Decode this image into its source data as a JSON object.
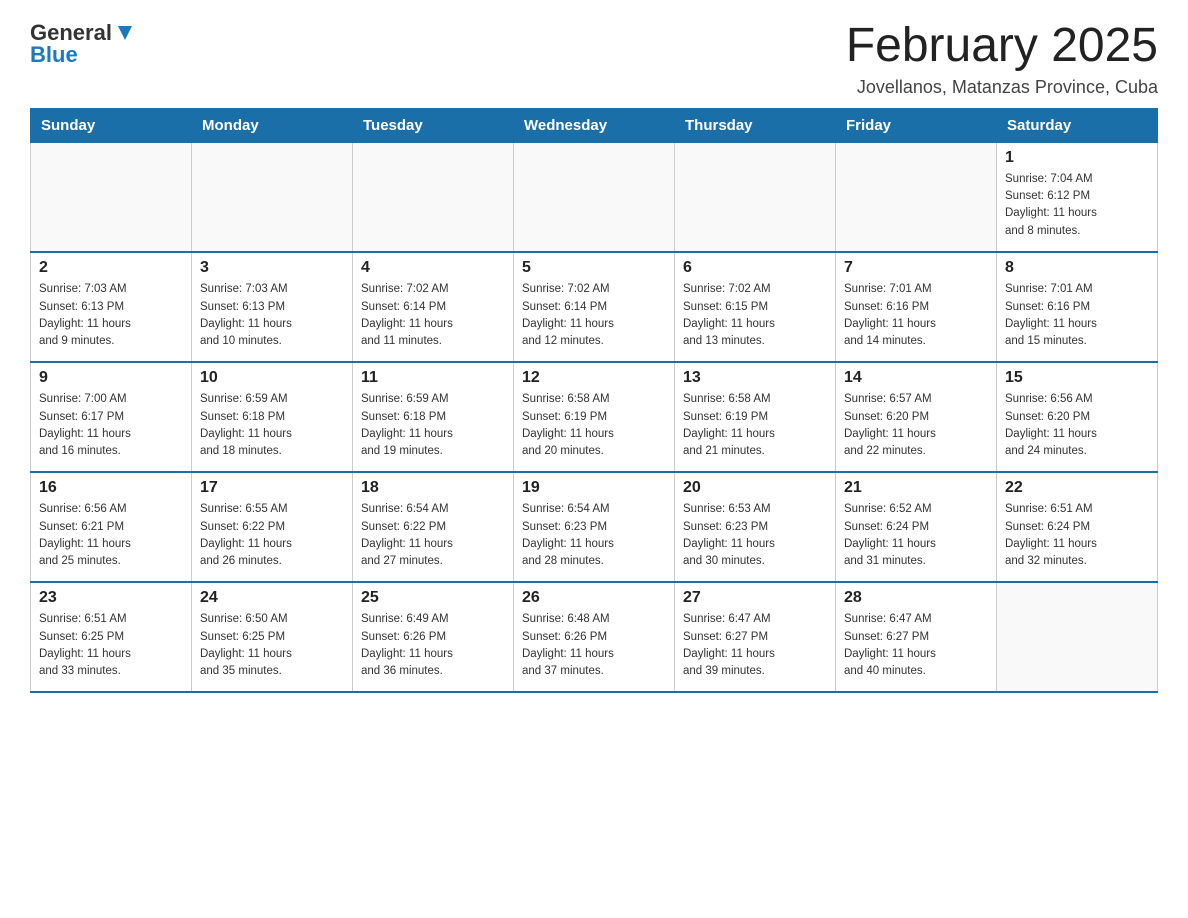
{
  "logo": {
    "general": "General",
    "blue": "Blue"
  },
  "title": "February 2025",
  "subtitle": "Jovellanos, Matanzas Province, Cuba",
  "headers": [
    "Sunday",
    "Monday",
    "Tuesday",
    "Wednesday",
    "Thursday",
    "Friday",
    "Saturday"
  ],
  "weeks": [
    [
      {
        "day": "",
        "info": ""
      },
      {
        "day": "",
        "info": ""
      },
      {
        "day": "",
        "info": ""
      },
      {
        "day": "",
        "info": ""
      },
      {
        "day": "",
        "info": ""
      },
      {
        "day": "",
        "info": ""
      },
      {
        "day": "1",
        "info": "Sunrise: 7:04 AM\nSunset: 6:12 PM\nDaylight: 11 hours\nand 8 minutes."
      }
    ],
    [
      {
        "day": "2",
        "info": "Sunrise: 7:03 AM\nSunset: 6:13 PM\nDaylight: 11 hours\nand 9 minutes."
      },
      {
        "day": "3",
        "info": "Sunrise: 7:03 AM\nSunset: 6:13 PM\nDaylight: 11 hours\nand 10 minutes."
      },
      {
        "day": "4",
        "info": "Sunrise: 7:02 AM\nSunset: 6:14 PM\nDaylight: 11 hours\nand 11 minutes."
      },
      {
        "day": "5",
        "info": "Sunrise: 7:02 AM\nSunset: 6:14 PM\nDaylight: 11 hours\nand 12 minutes."
      },
      {
        "day": "6",
        "info": "Sunrise: 7:02 AM\nSunset: 6:15 PM\nDaylight: 11 hours\nand 13 minutes."
      },
      {
        "day": "7",
        "info": "Sunrise: 7:01 AM\nSunset: 6:16 PM\nDaylight: 11 hours\nand 14 minutes."
      },
      {
        "day": "8",
        "info": "Sunrise: 7:01 AM\nSunset: 6:16 PM\nDaylight: 11 hours\nand 15 minutes."
      }
    ],
    [
      {
        "day": "9",
        "info": "Sunrise: 7:00 AM\nSunset: 6:17 PM\nDaylight: 11 hours\nand 16 minutes."
      },
      {
        "day": "10",
        "info": "Sunrise: 6:59 AM\nSunset: 6:18 PM\nDaylight: 11 hours\nand 18 minutes."
      },
      {
        "day": "11",
        "info": "Sunrise: 6:59 AM\nSunset: 6:18 PM\nDaylight: 11 hours\nand 19 minutes."
      },
      {
        "day": "12",
        "info": "Sunrise: 6:58 AM\nSunset: 6:19 PM\nDaylight: 11 hours\nand 20 minutes."
      },
      {
        "day": "13",
        "info": "Sunrise: 6:58 AM\nSunset: 6:19 PM\nDaylight: 11 hours\nand 21 minutes."
      },
      {
        "day": "14",
        "info": "Sunrise: 6:57 AM\nSunset: 6:20 PM\nDaylight: 11 hours\nand 22 minutes."
      },
      {
        "day": "15",
        "info": "Sunrise: 6:56 AM\nSunset: 6:20 PM\nDaylight: 11 hours\nand 24 minutes."
      }
    ],
    [
      {
        "day": "16",
        "info": "Sunrise: 6:56 AM\nSunset: 6:21 PM\nDaylight: 11 hours\nand 25 minutes."
      },
      {
        "day": "17",
        "info": "Sunrise: 6:55 AM\nSunset: 6:22 PM\nDaylight: 11 hours\nand 26 minutes."
      },
      {
        "day": "18",
        "info": "Sunrise: 6:54 AM\nSunset: 6:22 PM\nDaylight: 11 hours\nand 27 minutes."
      },
      {
        "day": "19",
        "info": "Sunrise: 6:54 AM\nSunset: 6:23 PM\nDaylight: 11 hours\nand 28 minutes."
      },
      {
        "day": "20",
        "info": "Sunrise: 6:53 AM\nSunset: 6:23 PM\nDaylight: 11 hours\nand 30 minutes."
      },
      {
        "day": "21",
        "info": "Sunrise: 6:52 AM\nSunset: 6:24 PM\nDaylight: 11 hours\nand 31 minutes."
      },
      {
        "day": "22",
        "info": "Sunrise: 6:51 AM\nSunset: 6:24 PM\nDaylight: 11 hours\nand 32 minutes."
      }
    ],
    [
      {
        "day": "23",
        "info": "Sunrise: 6:51 AM\nSunset: 6:25 PM\nDaylight: 11 hours\nand 33 minutes."
      },
      {
        "day": "24",
        "info": "Sunrise: 6:50 AM\nSunset: 6:25 PM\nDaylight: 11 hours\nand 35 minutes."
      },
      {
        "day": "25",
        "info": "Sunrise: 6:49 AM\nSunset: 6:26 PM\nDaylight: 11 hours\nand 36 minutes."
      },
      {
        "day": "26",
        "info": "Sunrise: 6:48 AM\nSunset: 6:26 PM\nDaylight: 11 hours\nand 37 minutes."
      },
      {
        "day": "27",
        "info": "Sunrise: 6:47 AM\nSunset: 6:27 PM\nDaylight: 11 hours\nand 39 minutes."
      },
      {
        "day": "28",
        "info": "Sunrise: 6:47 AM\nSunset: 6:27 PM\nDaylight: 11 hours\nand 40 minutes."
      },
      {
        "day": "",
        "info": ""
      }
    ]
  ]
}
